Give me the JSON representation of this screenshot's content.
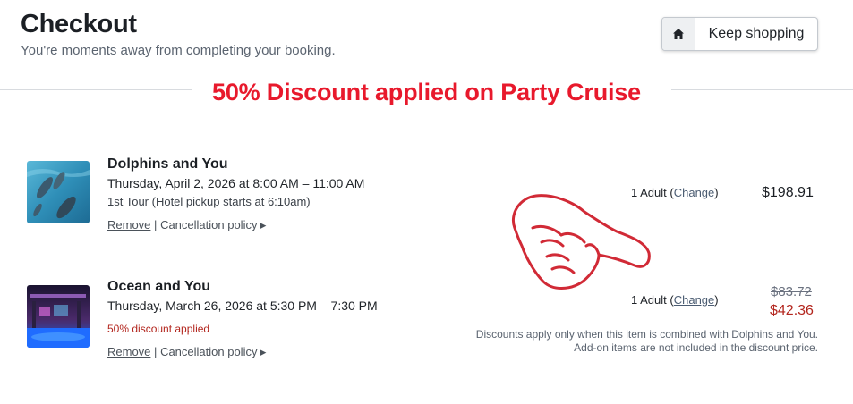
{
  "header": {
    "title": "Checkout",
    "subtitle": "You're moments away from completing your booking.",
    "keep_shopping": "Keep shopping"
  },
  "banner": "50% Discount applied on Party Cruise",
  "items": [
    {
      "name": "Dolphins and You",
      "date": "Thursday, April 2, 2026 at 8:00 AM – 11:00 AM",
      "note": "1st Tour (Hotel pickup starts at 6:10am)",
      "remove": "Remove",
      "sep": "|",
      "policy": "Cancellation policy",
      "qty": "1 Adult",
      "change": "Change",
      "price": "$198.91"
    },
    {
      "name": "Ocean and You",
      "date": "Thursday, March 26, 2026 at 5:30 PM – 7:30 PM",
      "note": "50% discount applied",
      "remove": "Remove",
      "sep": "|",
      "policy": "Cancellation policy",
      "qty": "1 Adult",
      "change": "Change",
      "price_old": "$83.72",
      "price_new": "$42.36"
    }
  ],
  "discount_note": {
    "line1": "Discounts apply only when this item is combined with Dolphins and You.",
    "line2": "Add-on items are not included in the discount price."
  },
  "colors": {
    "banner": "#e8192c",
    "discount": "#b3261e",
    "hand_outline": "#d12a36"
  },
  "icons": {
    "home": "home-icon",
    "hand": "pointing-hand-icon",
    "triangle": "triangle-right-icon"
  }
}
